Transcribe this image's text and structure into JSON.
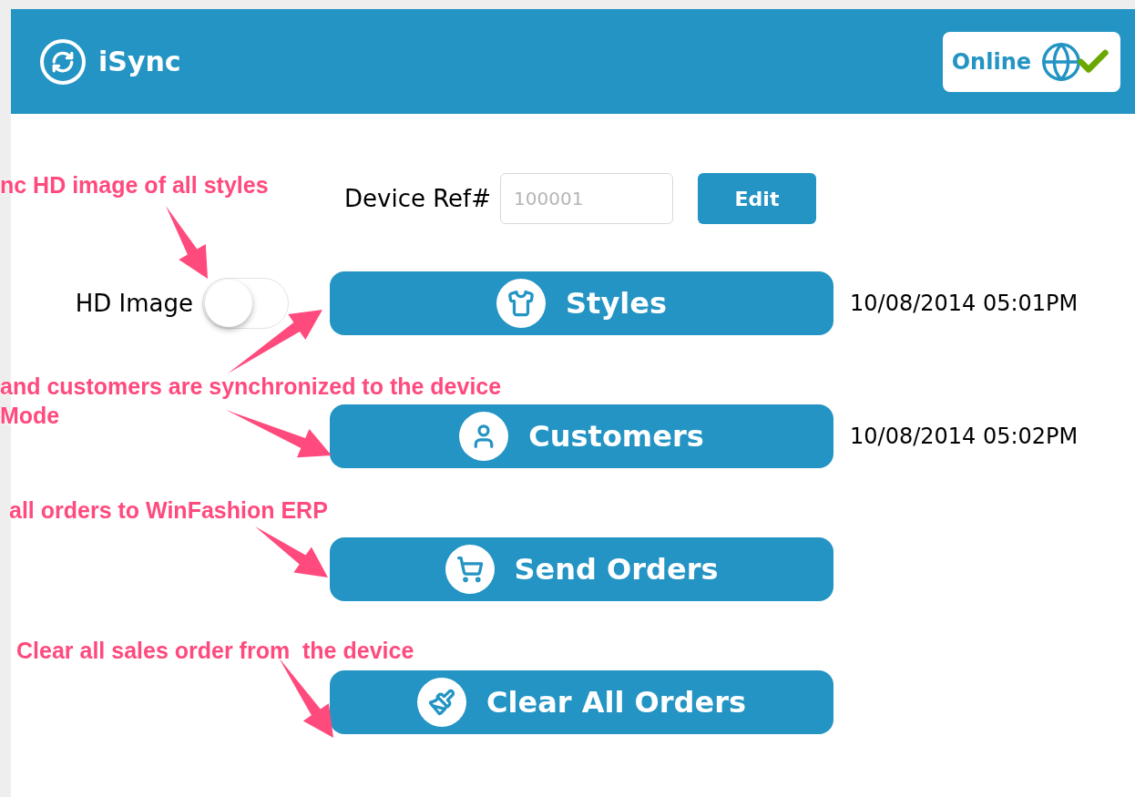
{
  "header": {
    "title": "iSync",
    "connection": {
      "label": "Online",
      "connected": true
    }
  },
  "device_ref": {
    "label": "Device Ref#",
    "placeholder": "100001",
    "button": "Edit"
  },
  "hd_image": {
    "label": "HD Image",
    "on": false
  },
  "actions": [
    {
      "kind": "styles",
      "label": "Styles",
      "timestamp": "10/08/2014 05:01PM"
    },
    {
      "kind": "customers",
      "label": "Customers",
      "timestamp": "10/08/2014 05:02PM"
    },
    {
      "kind": "send",
      "label": "Send Orders"
    },
    {
      "kind": "clear",
      "label": "Clear All Orders"
    }
  ],
  "annotations": [
    "nc HD image of all styles",
    "and customers are synchronized to the device",
    "Mode",
    "all orders to WinFashion ERP",
    "Clear all sales order from  the device"
  ]
}
